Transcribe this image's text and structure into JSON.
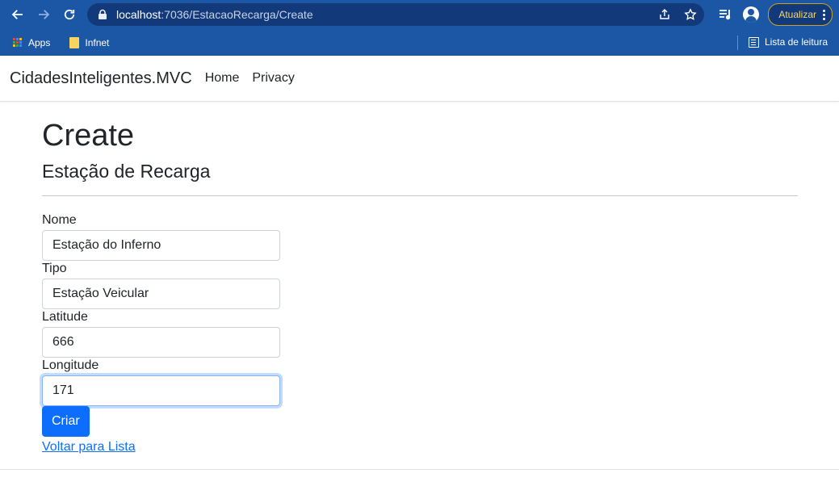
{
  "browser": {
    "url_host": "localhost",
    "url_rest": ":7036/EstacaoRecarga/Create",
    "update_button": "Atualizar",
    "bookmarks": [
      {
        "label": "Apps"
      },
      {
        "label": "Infnet"
      }
    ],
    "reading_list": "Lista de leitura",
    "colors": {
      "chrome": "#1c57a5",
      "omnibox": "#12397a"
    }
  },
  "navbar": {
    "brand": "CidadesInteligentes.MVC",
    "links": [
      {
        "label": "Home"
      },
      {
        "label": "Privacy"
      }
    ]
  },
  "page": {
    "title": "Create",
    "subtitle": "Estação de Recarga",
    "fields": [
      {
        "label": "Nome",
        "value": "Estação do Inferno"
      },
      {
        "label": "Tipo",
        "value": "Estação Veicular"
      },
      {
        "label": "Latitude",
        "value": "666"
      },
      {
        "label": "Longitude",
        "value": "171"
      }
    ],
    "submit_label": "Criar",
    "back_link": "Voltar para Lista",
    "colors": {
      "primary": "#0d6efd"
    }
  }
}
